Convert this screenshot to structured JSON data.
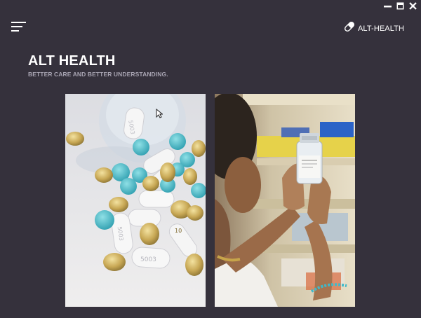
{
  "window": {
    "controls": [
      "minimize",
      "maximize",
      "close"
    ]
  },
  "header": {
    "menu_icon": "hamburger-menu-icon",
    "brand_icon": "pill-icon",
    "brand_label": "ALT-HEALTH"
  },
  "hero": {
    "title": "ALT HEALTH",
    "subtitle": "BETTER CARE AND BETTER UNDERSTANDING."
  },
  "gallery": {
    "images": [
      {
        "name": "pills-photo",
        "pill_markings": [
          "5003",
          "5003",
          "10",
          "10",
          "5003",
          "5003"
        ]
      },
      {
        "name": "vial-photo"
      }
    ]
  },
  "colors": {
    "background": "#35313c",
    "text": "#ffffff",
    "subtitle": "#a8a4b2"
  }
}
